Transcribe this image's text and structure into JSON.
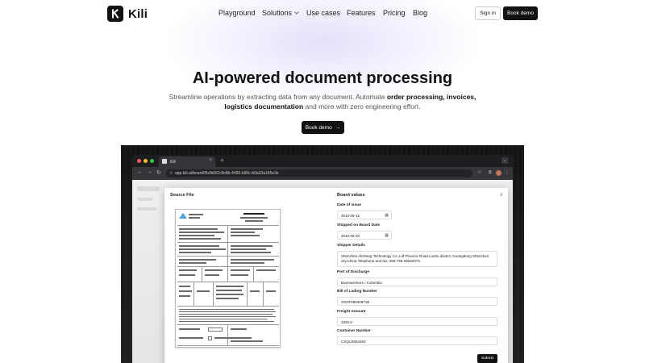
{
  "nav": {
    "brand": "Kili",
    "links": [
      {
        "label": "Playground"
      },
      {
        "label": "Solutions"
      },
      {
        "label": "Use cases"
      },
      {
        "label": "Features"
      },
      {
        "label": "Pricing"
      },
      {
        "label": "Blog"
      }
    ],
    "signin_label": "Sign in",
    "book_demo_label": "Book demo"
  },
  "hero": {
    "title": "AI-powered document processing",
    "sub_1": "Streamline operations by extracting data from any document. Automate ",
    "sub_bold_1": "order processing, invoices,",
    "sub_bold_2": "logistics documentation",
    "sub_2": " and more with zero engineering effort.",
    "cta_label": "Book demo",
    "cta_arrow": "→"
  },
  "browser": {
    "tab_title": "Kili",
    "tab_close": "×",
    "new_tab": "+",
    "tab_menu": "⌄",
    "url": "app.kili.ai/board/f6cfb663-8e8b-4466-b90c-b0a33a185e3e",
    "nav_back": "←",
    "nav_forward": "→",
    "nav_reload": "↻",
    "url_secure": "⊙",
    "bookmark": "☆",
    "more": "⋮"
  },
  "modal": {
    "close": "×",
    "source_title": "Source File",
    "board_title": "Board values",
    "fields": [
      {
        "label": "Date of issue",
        "value": "2010-08-15"
      },
      {
        "label": "Shipped on Board Date",
        "value": "2010-08-20"
      },
      {
        "label": "Shipper Details",
        "value": "Shenzhen Alishang Technology Co.,Ltd Phoenix Road,Luohu district, Guangdong Shenzhen city,China Telephone and fax: 086-755-36922075"
      },
      {
        "label": "Port of Discharge",
        "value": "Buenaventure / Colombia"
      },
      {
        "label": "Bill of Lading Number",
        "value": "SSOF09040671B"
      },
      {
        "label": "Freight Amount",
        "value": "3300.0"
      },
      {
        "label": "Container Number",
        "value": "CSQU3054383"
      }
    ],
    "submit_label": "Submit"
  },
  "colors": {
    "brand_dark": "#111111",
    "accent_glow": "#c4baf5"
  },
  "icons": {
    "calendar": "calendar-icon",
    "logo": "kili-logo-icon"
  }
}
